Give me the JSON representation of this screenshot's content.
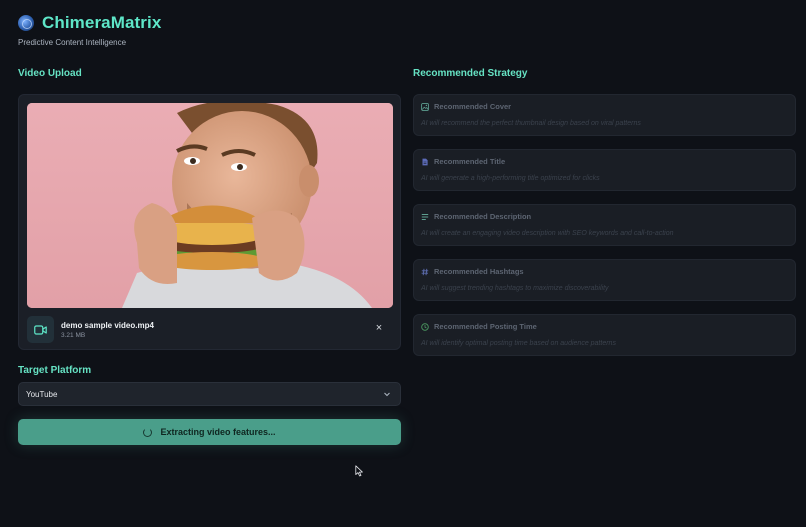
{
  "app": {
    "title": "ChimeraMatrix",
    "subtitle": "Predictive Content Intelligence"
  },
  "upload": {
    "section_title": "Video Upload",
    "file_name": "demo sample video.mp4",
    "file_size": "3.21 MB",
    "close_glyph": "×"
  },
  "platform": {
    "section_title": "Target Platform",
    "selected": "YouTube"
  },
  "extract": {
    "label": "Extracting video features..."
  },
  "strategy": {
    "section_title": "Recommended Strategy",
    "items": [
      {
        "title": "Recommended Cover",
        "desc": "AI will recommend the perfect thumbnail design based on viral patterns",
        "icon": "image-icon"
      },
      {
        "title": "Recommended Title",
        "desc": "AI will generate a high-performing title optimized for clicks",
        "icon": "document-icon"
      },
      {
        "title": "Recommended Description",
        "desc": "AI will create an engaging video description with SEO keywords and call-to-action",
        "icon": "lines-icon"
      },
      {
        "title": "Recommended Hashtags",
        "desc": "AI will suggest trending hashtags to maximize discoverability",
        "icon": "hash-icon"
      },
      {
        "title": "Recommended Posting Time",
        "desc": "AI will identify optimal posting time based on audience patterns",
        "icon": "clock-icon"
      }
    ]
  },
  "colors": {
    "accent": "#5ee6c8",
    "button": "#4a9e8a",
    "background": "#0e1117",
    "card": "#1b1f27"
  }
}
